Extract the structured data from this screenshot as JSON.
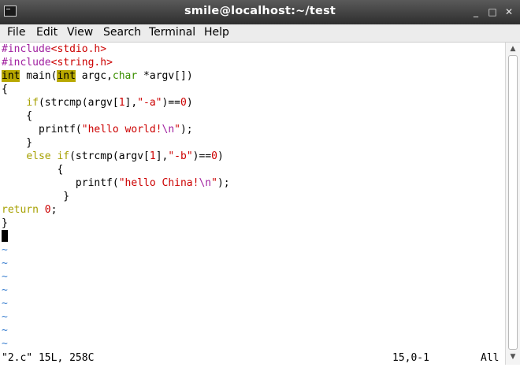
{
  "window": {
    "title": "smile@localhost:~/test",
    "minimize": "_",
    "maximize": "□",
    "close": "✕"
  },
  "menu": [
    "File",
    "Edit",
    "View",
    "Search",
    "Terminal",
    "Help"
  ],
  "code": {
    "l1a": "#include",
    "l1b": "<stdio.h>",
    "l2a": "#include",
    "l2b": "<string.h>",
    "l3a": "int",
    "l3b": " main(",
    "l3c": "int",
    "l3d": " argc,",
    "l3e": "char",
    "l3f": " *argv[])",
    "l4": "{",
    "l5a": "    ",
    "l5b": "if",
    "l5c": "(strcmp(argv[",
    "l5d": "1",
    "l5e": "],",
    "l5f": "\"-a\"",
    "l5g": ")==",
    "l5h": "0",
    "l5i": ")",
    "l6": "    {",
    "l7a": "      printf(",
    "l7b": "\"hello world!",
    "l7c": "\\n",
    "l7d": "\"",
    "l7e": ");",
    "l8": "    }",
    "l9a": "    ",
    "l9b": "else",
    "l9c": " ",
    "l9d": "if",
    "l9e": "(strcmp(argv[",
    "l9f": "1",
    "l9g": "],",
    "l9h": "\"-b\"",
    "l9i": ")==",
    "l9j": "0",
    "l9k": ")",
    "l10": "         {",
    "l11a": "            printf(",
    "l11b": "\"hello China!",
    "l11c": "\\n",
    "l11d": "\"",
    "l11e": ");",
    "l12": "          }",
    "l13a": "return",
    "l13b": " ",
    "l13c": "0",
    "l13d": ";",
    "l14": "}"
  },
  "tilde": "~",
  "status": {
    "file": "\"2.c\" 15L, 258C",
    "position": "15,0-1",
    "scroll": "All"
  }
}
